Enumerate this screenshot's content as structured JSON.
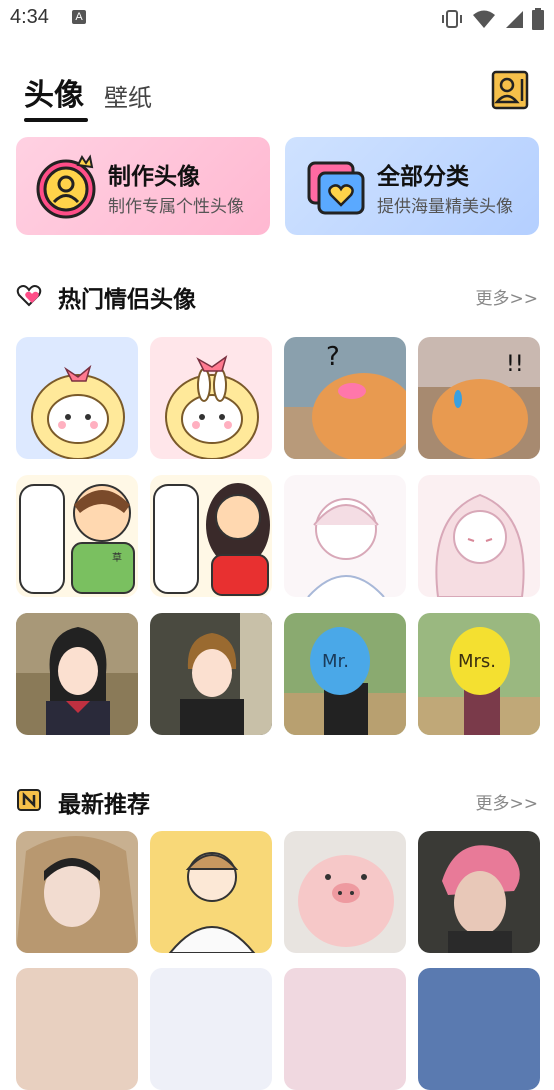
{
  "status_bar": {
    "time": "4:34",
    "app_icon_letter": "A"
  },
  "tabs": {
    "active": "头像",
    "inactive": "壁纸"
  },
  "cards": {
    "make": {
      "title": "制作头像",
      "subtitle": "制作专属个性头像"
    },
    "all": {
      "title": "全部分类",
      "subtitle": "提供海量精美头像"
    }
  },
  "sections": {
    "hot_couple": {
      "title": "热门情侣头像",
      "more": "更多>>"
    },
    "latest": {
      "title": "最新推荐",
      "more": "更多>>"
    }
  },
  "colors": {
    "accent_orange": "#f0a030",
    "pink_card": "#ffb8d1",
    "blue_card": "#b4cfff"
  },
  "hot_couple_items": [
    {
      "thumb": "sheep-pink-left"
    },
    {
      "thumb": "sheep-pink-right"
    },
    {
      "thumb": "orange-cat-question"
    },
    {
      "thumb": "orange-cat-exclaim"
    },
    {
      "thumb": "cartoon-boy-alpaca"
    },
    {
      "thumb": "cartoon-girl-alpaca"
    },
    {
      "thumb": "sketch-boy"
    },
    {
      "thumb": "sketch-girl-crying"
    },
    {
      "thumb": "anime-girl-uniform"
    },
    {
      "thumb": "anime-boy-uniform"
    },
    {
      "thumb": "balloon-mr"
    },
    {
      "thumb": "balloon-mrs"
    }
  ],
  "latest_items": [
    {
      "thumb": "girl-hood"
    },
    {
      "thumb": "illustrated-boy"
    },
    {
      "thumb": "pink-pig-hat"
    },
    {
      "thumb": "pink-hair-boy"
    }
  ],
  "balloon_labels": {
    "mr": "Mr.",
    "mrs": "Mrs."
  }
}
